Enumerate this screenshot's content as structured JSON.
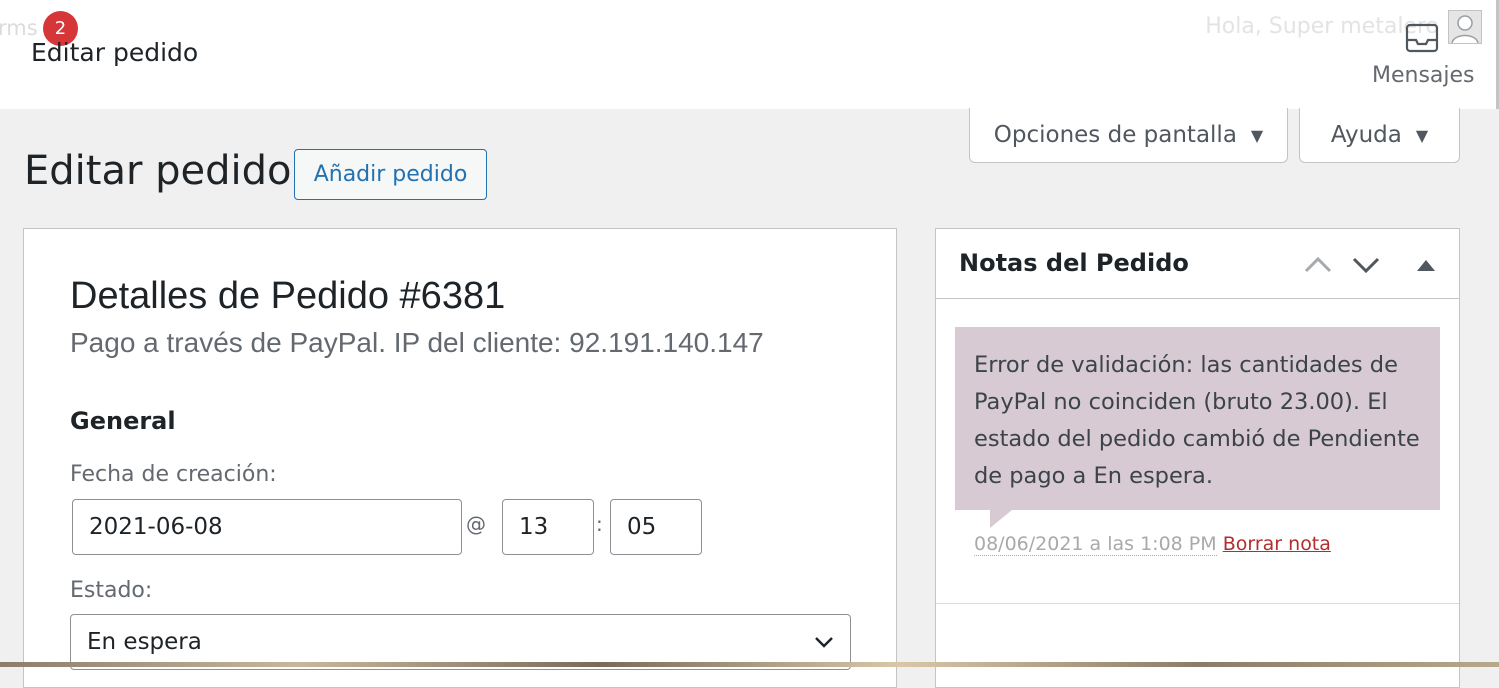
{
  "topbar": {
    "crumb_fragment": "rms",
    "badge_count": "2",
    "title": "Editar pedido",
    "greeting": "Hola, Super metalero",
    "messages_label": "Mensajes"
  },
  "screen_options": {
    "label": "Opciones de pantalla"
  },
  "help": {
    "label": "Ayuda"
  },
  "heading": {
    "title": "Editar pedido",
    "add_button": "Añadir pedido"
  },
  "order": {
    "title": "Detalles de Pedido #6381",
    "subtitle": "Pago a través de PayPal. IP del cliente: 92.191.140.147",
    "section_general": "General",
    "creation_date_label": "Fecha de creación:",
    "date_value": "2021-06-08",
    "at_symbol": "@",
    "hour_value": "13",
    "colon": ":",
    "minute_value": "05",
    "status_label": "Estado:",
    "status_value": "En espera"
  },
  "notes": {
    "title": "Notas del Pedido",
    "note_text": "Error de validación: las cantidades de PayPal no coinciden (bruto 23.00). El estado del pedido cambió de Pendiente de pago a En espera.",
    "note_date": "08/06/2021 a las 1:08 PM",
    "delete_label": "Borrar nota"
  },
  "colors": {
    "accent": "#2271b1",
    "badge": "#d63638",
    "note_bg": "#d7cad2",
    "delete_link": "#b32d2e"
  },
  "icons": {
    "inbox": "inbox-icon",
    "avatar": "user-avatar",
    "move_up": "chevron-up-icon",
    "move_down": "chevron-down-icon",
    "toggle": "triangle-up-icon",
    "select": "chevron-down-icon"
  }
}
